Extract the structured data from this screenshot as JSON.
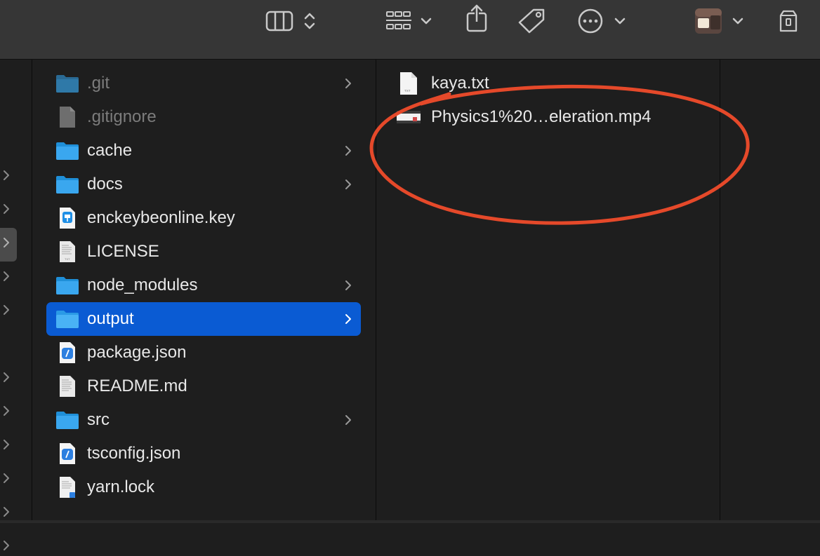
{
  "colors": {
    "selection": "#0a5bd3",
    "folder": "#3aa7ef",
    "annotation": "#e5492a",
    "background": "#1e1e1e",
    "toolbar": "#363636"
  },
  "toolbar": {
    "icons": [
      "column-view-icon",
      "view-options-chevron-icon",
      "group-icon",
      "chevron-down-icon",
      "share-icon",
      "tag-icon",
      "more-actions-icon",
      "chevron-down-icon",
      "avatar",
      "chevron-down-icon",
      "storage-icon"
    ]
  },
  "column1": {
    "items": [
      {
        "name": ".git",
        "kind": "folder",
        "dim": true,
        "has_children": true
      },
      {
        "name": ".gitignore",
        "kind": "file-generic",
        "dim": true,
        "has_children": false
      },
      {
        "name": "cache",
        "kind": "folder",
        "dim": false,
        "has_children": true
      },
      {
        "name": "docs",
        "kind": "folder",
        "dim": false,
        "has_children": true
      },
      {
        "name": "enckeybeonline.key",
        "kind": "keynote-file",
        "dim": false,
        "has_children": false
      },
      {
        "name": "LICENSE",
        "kind": "text-file",
        "dim": false,
        "has_children": false
      },
      {
        "name": "node_modules",
        "kind": "folder",
        "dim": false,
        "has_children": true
      },
      {
        "name": "output",
        "kind": "folder",
        "dim": false,
        "has_children": true,
        "selected": true
      },
      {
        "name": "package.json",
        "kind": "json-file",
        "dim": false,
        "has_children": false
      },
      {
        "name": "README.md",
        "kind": "text-file",
        "dim": false,
        "has_children": false
      },
      {
        "name": "src",
        "kind": "folder",
        "dim": false,
        "has_children": true
      },
      {
        "name": "tsconfig.json",
        "kind": "json-file",
        "dim": false,
        "has_children": false
      },
      {
        "name": "yarn.lock",
        "kind": "lock-file",
        "dim": false,
        "has_children": false
      }
    ]
  },
  "column2": {
    "items": [
      {
        "name": "kaya.txt",
        "kind": "txt-file"
      },
      {
        "name": "Physics1%20…eleration.mp4",
        "kind": "video-file"
      }
    ]
  }
}
